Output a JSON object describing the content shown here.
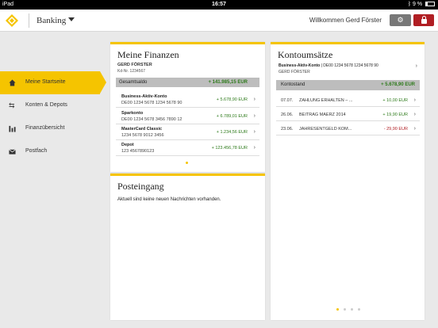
{
  "status_bar": {
    "device": "iPad",
    "time": "16:57",
    "battery": "9 %"
  },
  "header": {
    "app_title": "Banking",
    "welcome": "Willkommen Gerd Förster",
    "settings_icon": "gear-icon",
    "logout_icon": "lock-icon",
    "brand_color": "#f5c400",
    "logout_color": "#b01e23"
  },
  "sidebar": {
    "items": [
      {
        "label": "Meine Startseite",
        "icon": "home-icon",
        "active": true
      },
      {
        "label": "Konten & Depots",
        "icon": "transfer-arrows-icon",
        "active": false
      },
      {
        "label": "Finanzübersicht",
        "icon": "bar-chart-icon",
        "active": false
      },
      {
        "label": "Postfach",
        "icon": "envelope-icon",
        "active": false
      }
    ]
  },
  "finances": {
    "title": "Meine Finanzen",
    "owner": "GERD FÖRSTER",
    "customer_no": "Kd-Nr. 1234567",
    "total_label": "Gesamtsaldo",
    "total_amount": "+ 141.985,15 EUR",
    "accounts": [
      {
        "name": "Business-Aktiv-Konto",
        "number": "DE00 1234 5678 1234 5678 90",
        "amount": "+ 5.678,90 EUR"
      },
      {
        "name": "Sparkonto",
        "number": "DE00 1234 5678 3456 7890 12",
        "amount": "+ 6.789,01 EUR"
      },
      {
        "name": "MasterCard Classic",
        "number": "1234 5678 9012 3456",
        "amount": "+ 1.234,56 EUR"
      },
      {
        "name": "Depot",
        "number": "123 4567890123",
        "amount": "+ 123.456,78 EUR"
      }
    ]
  },
  "inbox": {
    "title": "Posteingang",
    "message": "Aktuell sind keine neuen Nachrichten vorhanden."
  },
  "transactions": {
    "title": "Kontoumsätze",
    "account_name": "Business-Aktiv-Konto",
    "account_iban": " | DE00 1234 5678 1234 5678 90",
    "owner": "GERD FÖRSTER",
    "balance_label": "Kontostand",
    "balance_amount": "+ 5.678,90 EUR",
    "items": [
      {
        "date": "07.07.",
        "text": "ZAHLUNG ERHALTEN – ...",
        "amount": "+ 10,00 EUR",
        "sign": "pos"
      },
      {
        "date": "26.06.",
        "text": "BEITRAG MAERZ 2014",
        "amount": "+ 19,90 EUR",
        "sign": "pos"
      },
      {
        "date": "23.06.",
        "text": "JAHRESENTGELD KOM...",
        "amount": "- 29,90 EUR",
        "sign": "neg"
      }
    ]
  }
}
